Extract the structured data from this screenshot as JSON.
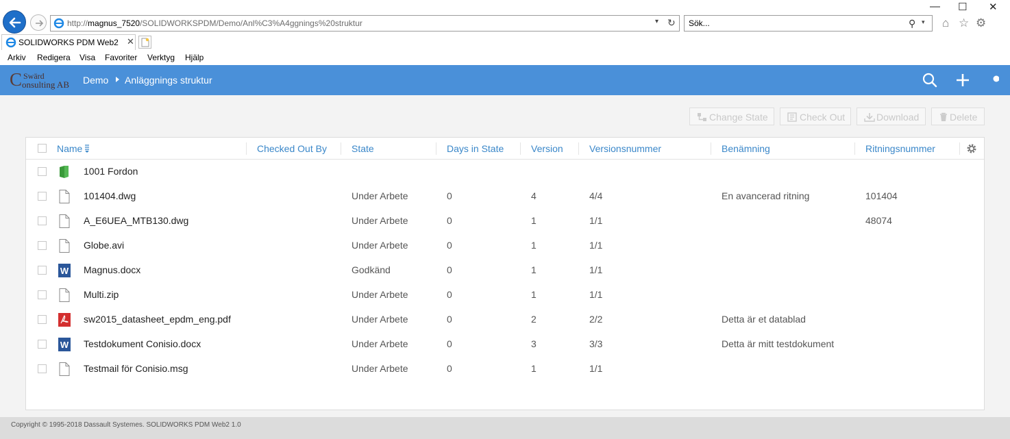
{
  "browser": {
    "url_prefix": "http://",
    "url_host": "magnus_7520",
    "url_path": "/SOLIDWORKSPDM/Demo/Anl%C3%A4ggnings%20struktur",
    "search_placeholder": "Sök...",
    "tab_title": "SOLIDWORKS PDM Web2",
    "menu": [
      "Arkiv",
      "Redigera",
      "Visa",
      "Favoriter",
      "Verktyg",
      "Hjälp"
    ]
  },
  "header": {
    "logo_initial": "C",
    "logo_line1": "Swärd",
    "logo_line2": "onsulting AB",
    "breadcrumb": [
      "Demo",
      "Anläggnings struktur"
    ],
    "brand_color": "#4a90d9"
  },
  "toolbar": {
    "change_state": "Change State",
    "check_out": "Check Out",
    "download": "Download",
    "delete": "Delete"
  },
  "columns": [
    "Name",
    "Checked Out By",
    "State",
    "Days in State",
    "Version",
    "Versionsnummer",
    "Benämning",
    "Ritningsnummer"
  ],
  "rows": [
    {
      "icon": "folder-icon",
      "name": "1001 Fordon",
      "checked_out_by": "",
      "state": "",
      "days": "",
      "version": "",
      "versionsnummer": "",
      "benamning": "",
      "ritningsnummer": ""
    },
    {
      "icon": "file-icon",
      "name": "101404.dwg",
      "checked_out_by": "",
      "state": "Under Arbete",
      "days": "0",
      "version": "4",
      "versionsnummer": "4/4",
      "benamning": "En avancerad ritning",
      "ritningsnummer": "101404"
    },
    {
      "icon": "file-icon",
      "name": "A_E6UEA_MTB130.dwg",
      "checked_out_by": "",
      "state": "Under Arbete",
      "days": "0",
      "version": "1",
      "versionsnummer": "1/1",
      "benamning": "",
      "ritningsnummer": "48074"
    },
    {
      "icon": "file-icon",
      "name": "Globe.avi",
      "checked_out_by": "",
      "state": "Under Arbete",
      "days": "0",
      "version": "1",
      "versionsnummer": "1/1",
      "benamning": "",
      "ritningsnummer": ""
    },
    {
      "icon": "word-icon",
      "name": "Magnus.docx",
      "checked_out_by": "",
      "state": "Godkänd",
      "days": "0",
      "version": "1",
      "versionsnummer": "1/1",
      "benamning": "",
      "ritningsnummer": ""
    },
    {
      "icon": "file-icon",
      "name": "Multi.zip",
      "checked_out_by": "",
      "state": "Under Arbete",
      "days": "0",
      "version": "1",
      "versionsnummer": "1/1",
      "benamning": "",
      "ritningsnummer": ""
    },
    {
      "icon": "pdf-icon",
      "name": "sw2015_datasheet_epdm_eng.pdf",
      "checked_out_by": "",
      "state": "Under Arbete",
      "days": "0",
      "version": "2",
      "versionsnummer": "2/2",
      "benamning": "Detta är et datablad",
      "ritningsnummer": ""
    },
    {
      "icon": "word-icon",
      "name": "Testdokument Conisio.docx",
      "checked_out_by": "",
      "state": "Under Arbete",
      "days": "0",
      "version": "3",
      "versionsnummer": "3/3",
      "benamning": "Detta är mitt testdokument",
      "ritningsnummer": ""
    },
    {
      "icon": "file-icon",
      "name": "Testmail för Conisio.msg",
      "checked_out_by": "",
      "state": "Under Arbete",
      "days": "0",
      "version": "1",
      "versionsnummer": "1/1",
      "benamning": "",
      "ritningsnummer": ""
    }
  ],
  "footer": {
    "copyright": "Copyright © 1995-2018 Dassault Systemes. SOLIDWORKS PDM Web2 1.0"
  }
}
